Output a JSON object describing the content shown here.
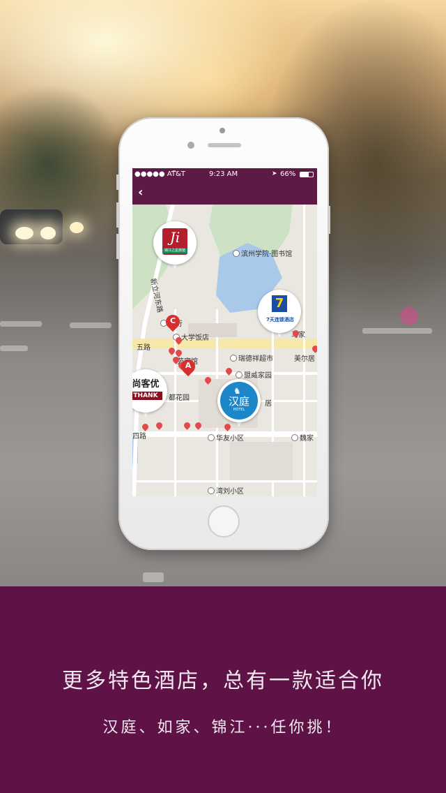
{
  "status_bar": {
    "carrier": "●●●●● AT&T",
    "time": "9:23 AM",
    "battery": "66%",
    "icons": [
      "signal-icon",
      "wifi-icon",
      "location-arrow-icon",
      "battery-icon"
    ]
  },
  "navbar": {
    "back_icon": "chevron-left-icon",
    "back_glyph": "‹"
  },
  "map": {
    "roads": [
      "新立河东路",
      "五路",
      "四路"
    ],
    "pois": [
      "滨州学院·图书馆",
      "银行",
      "大学饭店",
      "瑞德祥超市",
      "美尔居",
      "马家",
      "苑宾馆",
      "盟威家园",
      "都花园",
      "居",
      "华友小区",
      "魏家",
      "湾刘小区"
    ],
    "hotels": {
      "jinjiang": {
        "logo": "Ji",
        "caption": "锦江之星旅馆"
      },
      "seven_days": {
        "logo": "7",
        "caption": "7天连锁酒店"
      },
      "thank": {
        "cn": "尚客优",
        "en": "THANK"
      },
      "hanting": {
        "cn": "汉庭",
        "en": "HOTEL"
      }
    },
    "pins": {
      "a": "A",
      "c": "C"
    }
  },
  "tagline": {
    "line1": "更多特色酒店，总有一款适合你",
    "line2": "汉庭、如家、锦江···任你挑！"
  }
}
